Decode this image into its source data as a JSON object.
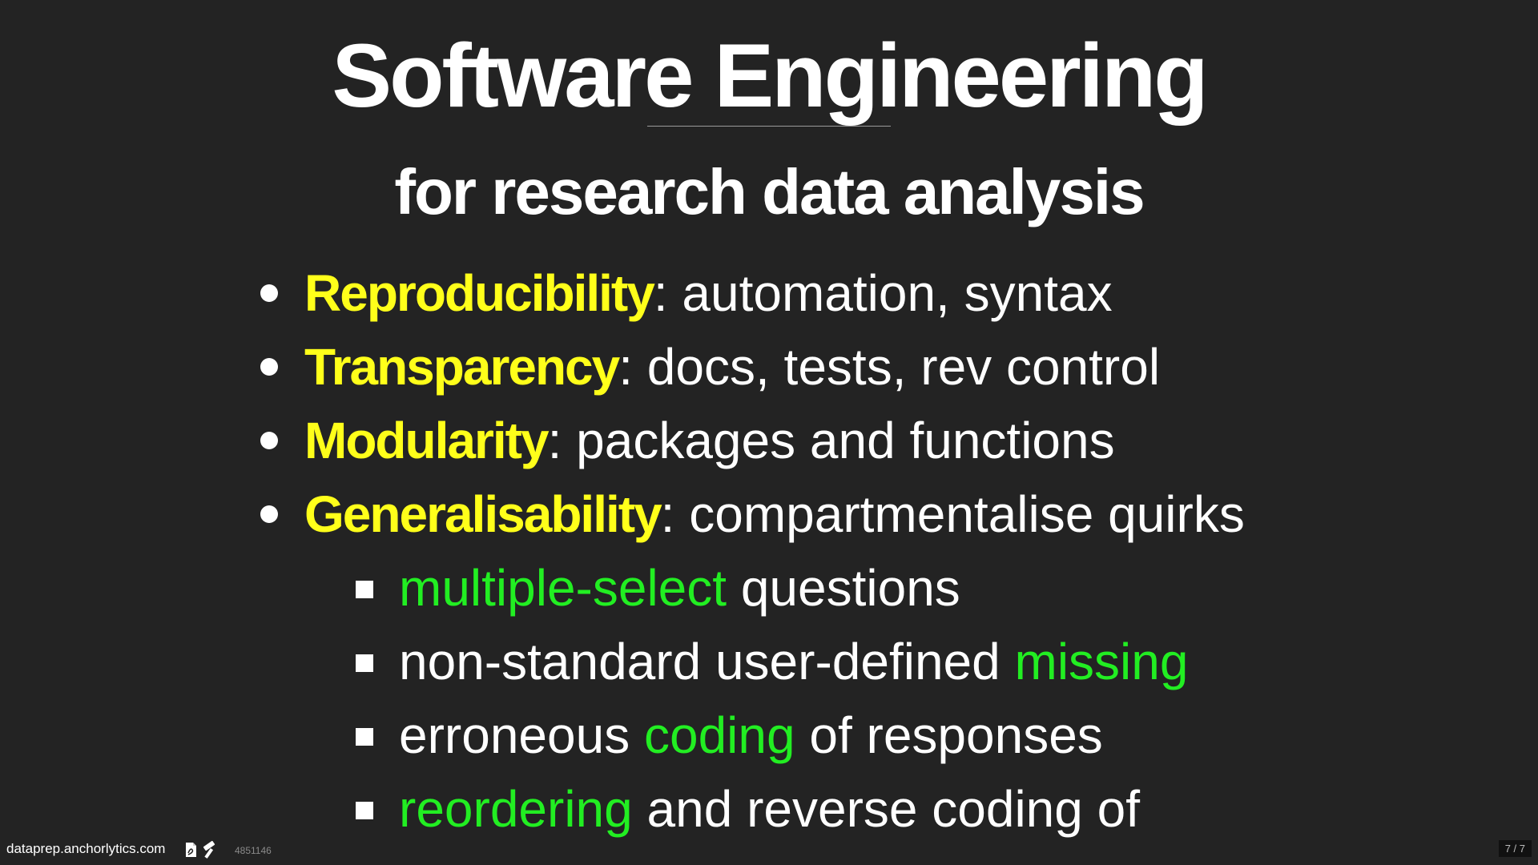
{
  "slide": {
    "title": "Software Engineering",
    "subtitle": "for research data analysis",
    "bullets": [
      {
        "keyword": "Reproducibility",
        "rest": ": automation, syntax"
      },
      {
        "keyword": "Transparency",
        "rest": ": docs, tests, rev control"
      },
      {
        "keyword": "Modularity",
        "rest": ": packages and functions"
      },
      {
        "keyword": "Generalisability",
        "rest": ": compartmentalise quirks"
      }
    ],
    "subbullets": [
      {
        "pre": "",
        "hl": "multiple-select",
        "post": " questions"
      },
      {
        "pre": "non-standard user-defined ",
        "hl": "missing",
        "post": ""
      },
      {
        "pre": "erroneous ",
        "hl": "coding",
        "post": " of responses"
      },
      {
        "pre": "",
        "hl": "reordering",
        "post": " and reverse coding of"
      }
    ]
  },
  "footer": {
    "url": "dataprep.anchorlytics.com",
    "id": "4851146",
    "icons": [
      "pdf-icon",
      "hammer-icon"
    ],
    "page": "7 / 7"
  },
  "colors": {
    "background": "#232323",
    "keyword": "#ffff1a",
    "highlight": "#22ee22",
    "text": "#ffffff"
  }
}
